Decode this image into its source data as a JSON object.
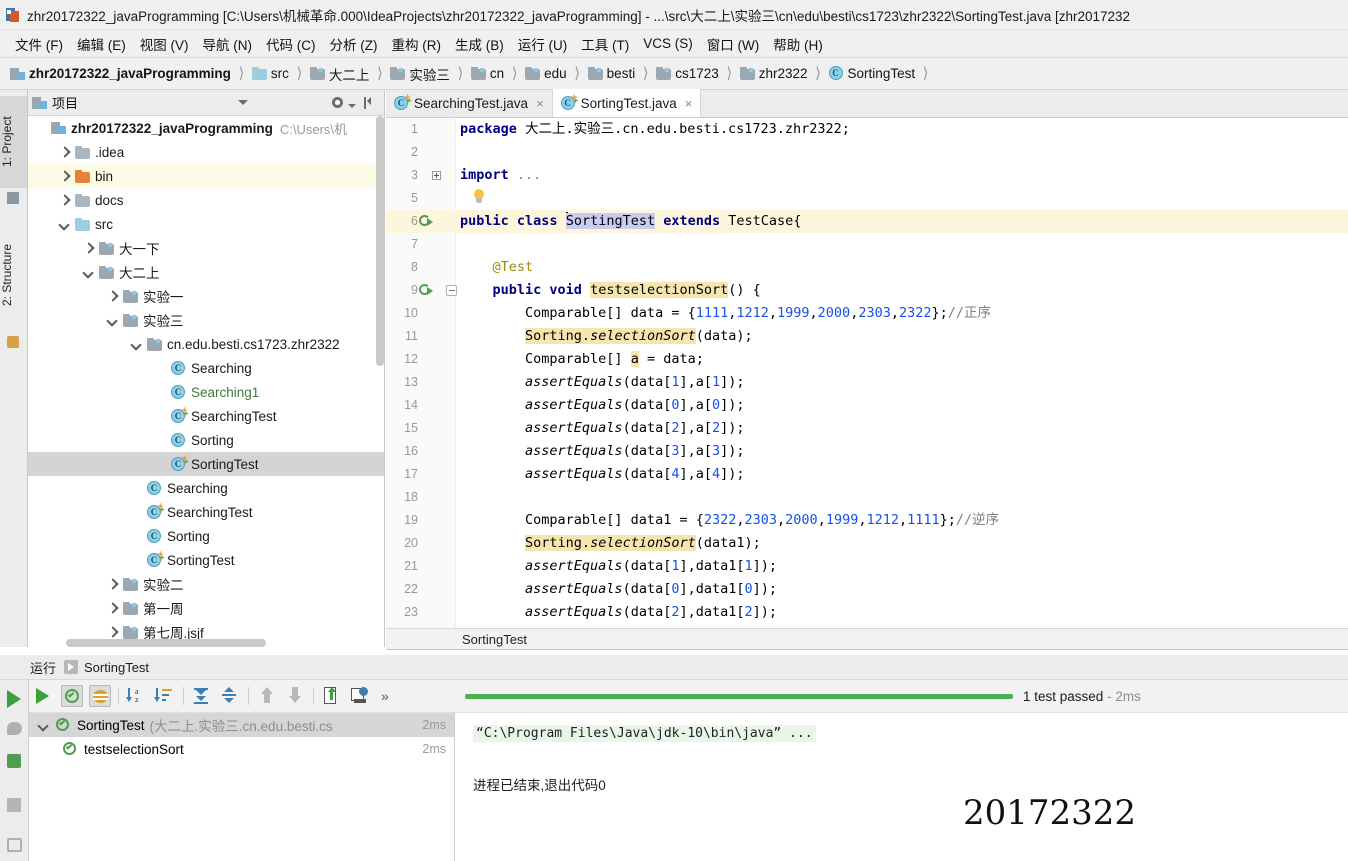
{
  "window": {
    "title": "zhr20172322_javaProgramming [C:\\Users\\机械革命.000\\IdeaProjects\\zhr20172322_javaProgramming] - ...\\src\\大二上\\实验三\\cn\\edu\\besti\\cs1723\\zhr2322\\SortingTest.java [zhr2017232",
    "app_icon": "intellij-idea-icon"
  },
  "menubar": {
    "items": [
      {
        "label": "文件 (F)"
      },
      {
        "label": "编辑 (E)"
      },
      {
        "label": "视图 (V)"
      },
      {
        "label": "导航 (N)"
      },
      {
        "label": "代码 (C)"
      },
      {
        "label": "分析 (Z)"
      },
      {
        "label": "重构 (R)"
      },
      {
        "label": "生成 (B)"
      },
      {
        "label": "运行 (U)"
      },
      {
        "label": "工具 (T)"
      },
      {
        "label": "VCS (S)"
      },
      {
        "label": "窗口 (W)"
      },
      {
        "label": "帮助 (H)"
      }
    ]
  },
  "breadcrumb": {
    "items": [
      {
        "label": "zhr20172322_javaProgramming",
        "icon": "project-icon"
      },
      {
        "label": "src",
        "icon": "source-folder-icon"
      },
      {
        "label": "大二上",
        "icon": "package-folder-icon"
      },
      {
        "label": "实验三",
        "icon": "package-folder-icon"
      },
      {
        "label": "cn",
        "icon": "package-folder-icon"
      },
      {
        "label": "edu",
        "icon": "package-folder-icon"
      },
      {
        "label": "besti",
        "icon": "package-folder-icon"
      },
      {
        "label": "cs1723",
        "icon": "package-folder-icon"
      },
      {
        "label": "zhr2322",
        "icon": "package-folder-icon"
      },
      {
        "label": "SortingTest",
        "icon": "java-class-icon"
      }
    ]
  },
  "tool_tabs": {
    "left": [
      {
        "label": "1: Project",
        "selected": true
      },
      {
        "label": "2: Structure",
        "selected": false
      }
    ]
  },
  "project_panel": {
    "title": "项目",
    "tree": [
      {
        "label": "zhr20172322_javaProgramming",
        "sub": "C:\\Users\\机",
        "depth": 0,
        "arrow": "none",
        "icon": "project-icon",
        "bold": true,
        "state": "normal"
      },
      {
        "label": ".idea",
        "depth": 1,
        "arrow": "right",
        "icon": "folder-icon",
        "state": "normal"
      },
      {
        "label": "bin",
        "depth": 1,
        "arrow": "right",
        "icon": "excluded-folder-icon",
        "state": "highlighted"
      },
      {
        "label": "docs",
        "depth": 1,
        "arrow": "right",
        "icon": "folder-icon",
        "state": "normal"
      },
      {
        "label": "src",
        "depth": 1,
        "arrow": "down",
        "icon": "source-folder-icon",
        "state": "normal"
      },
      {
        "label": "大一下",
        "depth": 2,
        "arrow": "right",
        "icon": "package-folder-icon",
        "state": "normal"
      },
      {
        "label": "大二上",
        "depth": 2,
        "arrow": "down",
        "icon": "package-folder-icon",
        "state": "normal"
      },
      {
        "label": "实验一",
        "depth": 3,
        "arrow": "right",
        "icon": "package-folder-icon",
        "state": "normal"
      },
      {
        "label": "实验三",
        "depth": 3,
        "arrow": "down",
        "icon": "package-folder-icon",
        "state": "normal"
      },
      {
        "label": "cn.edu.besti.cs1723.zhr2322",
        "depth": 4,
        "arrow": "down",
        "icon": "package-folder-icon",
        "state": "normal"
      },
      {
        "label": "Searching",
        "depth": 5,
        "arrow": "none",
        "icon": "java-class-icon",
        "state": "normal"
      },
      {
        "label": "Searching1",
        "depth": 5,
        "arrow": "none",
        "icon": "java-class-icon",
        "state": "green"
      },
      {
        "label": "SearchingTest",
        "depth": 5,
        "arrow": "none",
        "icon": "java-test-class-icon",
        "state": "normal"
      },
      {
        "label": "Sorting",
        "depth": 5,
        "arrow": "none",
        "icon": "java-class-icon",
        "state": "normal"
      },
      {
        "label": "SortingTest",
        "depth": 5,
        "arrow": "none",
        "icon": "java-test-class-icon",
        "state": "selected"
      },
      {
        "label": "Searching",
        "depth": 4,
        "arrow": "none",
        "icon": "java-class-icon",
        "state": "normal"
      },
      {
        "label": "SearchingTest",
        "depth": 4,
        "arrow": "none",
        "icon": "java-test-class-icon",
        "state": "normal"
      },
      {
        "label": "Sorting",
        "depth": 4,
        "arrow": "none",
        "icon": "java-class-icon",
        "state": "normal"
      },
      {
        "label": "SortingTest",
        "depth": 4,
        "arrow": "none",
        "icon": "java-test-class-icon",
        "state": "normal"
      },
      {
        "label": "实验二",
        "depth": 3,
        "arrow": "right",
        "icon": "package-folder-icon",
        "state": "normal"
      },
      {
        "label": "第一周",
        "depth": 3,
        "arrow": "right",
        "icon": "package-folder-icon",
        "state": "normal"
      },
      {
        "label": "第七周.jsjf",
        "depth": 3,
        "arrow": "right",
        "icon": "package-folder-icon",
        "state": "normal"
      }
    ]
  },
  "editor_tabs": [
    {
      "label": "SearchingTest.java",
      "icon": "java-test-class-icon",
      "active": false,
      "close": "×"
    },
    {
      "label": "SortingTest.java",
      "icon": "java-test-class-icon",
      "active": true,
      "close": "×"
    }
  ],
  "editor": {
    "status_text": "SortingTest",
    "lines": [
      {
        "num": "1",
        "html": "<span class=\"kw\">package</span> 大二上.实验三.cn.edu.besti.cs1723.zhr2322;",
        "gutter": "",
        "hl": false
      },
      {
        "num": "2",
        "html": "",
        "gutter": "",
        "hl": false
      },
      {
        "num": "3",
        "html": "<span class=\"kw\">import</span> <span class=\"cmt\">...</span>",
        "gutter": "fold-plus",
        "hl": false
      },
      {
        "num": "5",
        "html": "",
        "gutter": "bulb",
        "hl": false
      },
      {
        "num": "6",
        "html": "<span class=\"kw\">public class</span> <span class=\"caret\"></span><span class=\"sel-token\">SortingTest</span> <span class=\"kw\">extends</span> TestCase{",
        "gutter": "run",
        "hl": true
      },
      {
        "num": "7",
        "html": "",
        "gutter": "",
        "hl": false
      },
      {
        "num": "8",
        "html": "    <span class=\"ann\">@Test</span>",
        "gutter": "",
        "hl": false
      },
      {
        "num": "9",
        "html": "    <span class=\"kw\">public void</span> <span class=\"occur-hl\">testselectionSort</span>() {",
        "gutter": "run-fold",
        "hl": false
      },
      {
        "num": "10",
        "html": "        Comparable[] data = {<span class=\"num\">1111</span>,<span class=\"num\">1212</span>,<span class=\"num\">1999</span>,<span class=\"num\">2000</span>,<span class=\"num\">2303</span>,<span class=\"num\">2322</span>};<span class=\"cmt\">//正序</span>",
        "gutter": "",
        "hl": false
      },
      {
        "num": "11",
        "html": "        <span class=\"occur-hl\">Sorting.<span class=\"ital\">selectionSort</span></span>(data);",
        "gutter": "",
        "hl": false
      },
      {
        "num": "12",
        "html": "        Comparable[] <span class=\"occur-hl\">a</span> = data;",
        "gutter": "",
        "hl": false
      },
      {
        "num": "13",
        "html": "        <span class=\"ital\">assertEquals</span>(data[<span class=\"num\">1</span>],a[<span class=\"num\">1</span>]);",
        "gutter": "",
        "hl": false
      },
      {
        "num": "14",
        "html": "        <span class=\"ital\">assertEquals</span>(data[<span class=\"num\">0</span>],a[<span class=\"num\">0</span>]);",
        "gutter": "",
        "hl": false
      },
      {
        "num": "15",
        "html": "        <span class=\"ital\">assertEquals</span>(data[<span class=\"num\">2</span>],a[<span class=\"num\">2</span>]);",
        "gutter": "",
        "hl": false
      },
      {
        "num": "16",
        "html": "        <span class=\"ital\">assertEquals</span>(data[<span class=\"num\">3</span>],a[<span class=\"num\">3</span>]);",
        "gutter": "",
        "hl": false
      },
      {
        "num": "17",
        "html": "        <span class=\"ital\">assertEquals</span>(data[<span class=\"num\">4</span>],a[<span class=\"num\">4</span>]);",
        "gutter": "",
        "hl": false
      },
      {
        "num": "18",
        "html": "",
        "gutter": "",
        "hl": false
      },
      {
        "num": "19",
        "html": "        Comparable[] data1 = {<span class=\"num\">2322</span>,<span class=\"num\">2303</span>,<span class=\"num\">2000</span>,<span class=\"num\">1999</span>,<span class=\"num\">1212</span>,<span class=\"num\">1111</span>};<span class=\"cmt\">//逆序</span>",
        "gutter": "",
        "hl": false
      },
      {
        "num": "20",
        "html": "        <span class=\"occur-hl\">Sorting.<span class=\"ital\">selectionSort</span></span>(data1);",
        "gutter": "",
        "hl": false
      },
      {
        "num": "21",
        "html": "        <span class=\"ital\">assertEquals</span>(data[<span class=\"num\">1</span>],data1[<span class=\"num\">1</span>]);",
        "gutter": "",
        "hl": false
      },
      {
        "num": "22",
        "html": "        <span class=\"ital\">assertEquals</span>(data[<span class=\"num\">0</span>],data1[<span class=\"num\">0</span>]);",
        "gutter": "",
        "hl": false
      },
      {
        "num": "23",
        "html": "        <span class=\"ital\">assertEquals</span>(data[<span class=\"num\">2</span>],data1[<span class=\"num\">2</span>]);",
        "gutter": "",
        "hl": false
      }
    ]
  },
  "run_window": {
    "tab_label": "运行",
    "config_name": "SortingTest",
    "toolbar": [
      {
        "icon": "show-passed-icon",
        "pressed": true
      },
      {
        "icon": "show-ignored-icon",
        "pressed": true
      },
      {
        "icon": "sort-alphabetically-icon",
        "pressed": false
      },
      {
        "icon": "sort-by-duration-icon",
        "pressed": false
      },
      {
        "icon": "expand-all-icon",
        "pressed": false
      },
      {
        "icon": "collapse-all-icon",
        "pressed": false
      },
      {
        "icon": "previous-failed-icon",
        "pressed": false
      },
      {
        "icon": "next-failed-icon",
        "pressed": false
      },
      {
        "icon": "export-results-icon",
        "pressed": false
      },
      {
        "icon": "test-history-icon",
        "pressed": false
      },
      {
        "icon": "more-chevron-icon",
        "pressed": false
      }
    ],
    "left_icons": [
      {
        "icon": "rerun-icon"
      },
      {
        "icon": "rerun-failed-icon"
      },
      {
        "icon": "toggle-auto-test-icon"
      },
      {
        "icon": "stop-icon"
      },
      {
        "icon": "dump-threads-icon"
      }
    ],
    "tests": [
      {
        "label": "SortingTest",
        "suffix": "(大二上.实验三.cn.edu.besti.cs",
        "duration": "2ms",
        "depth": 0,
        "selected": true,
        "expanded": true
      },
      {
        "label": "testselectionSort",
        "suffix": "",
        "duration": "2ms",
        "depth": 1,
        "selected": false,
        "expanded": false
      }
    ],
    "progress": {
      "status": "1 test passed",
      "duration": "- 2ms",
      "percent": 100,
      "color": "#4caf50"
    },
    "console": {
      "command_line": "“C:\\Program Files\\Java\\jdk-10\\bin\\java” ...",
      "exit_line": "进程已结束,退出代码0"
    }
  },
  "watermark": "20172322"
}
